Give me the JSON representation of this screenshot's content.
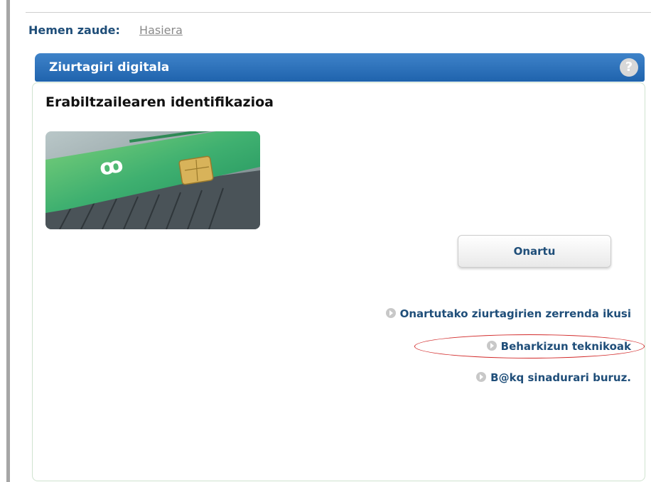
{
  "breadcrumb": {
    "label": "Hemen zaude:",
    "home_link": "Hasiera"
  },
  "panel": {
    "title": "Ziurtagiri digitala",
    "help_icon": "question-icon",
    "page_title": "Erabiltzailearen identifikazioa",
    "accept_button": "Onartu"
  },
  "links": [
    {
      "label": "Onartutako ziurtagirien zerrenda ikusi",
      "icon": "arrow-right-icon"
    },
    {
      "label": "Beharkizun teknikoak",
      "icon": "arrow-right-icon",
      "highlighted": true
    },
    {
      "label": "B@kq sinadurari buruz.",
      "icon": "arrow-right-icon"
    }
  ],
  "colors": {
    "header_bg": "#2a70bd",
    "link_text": "#1f4e79",
    "highlight": "#d22a2a"
  }
}
